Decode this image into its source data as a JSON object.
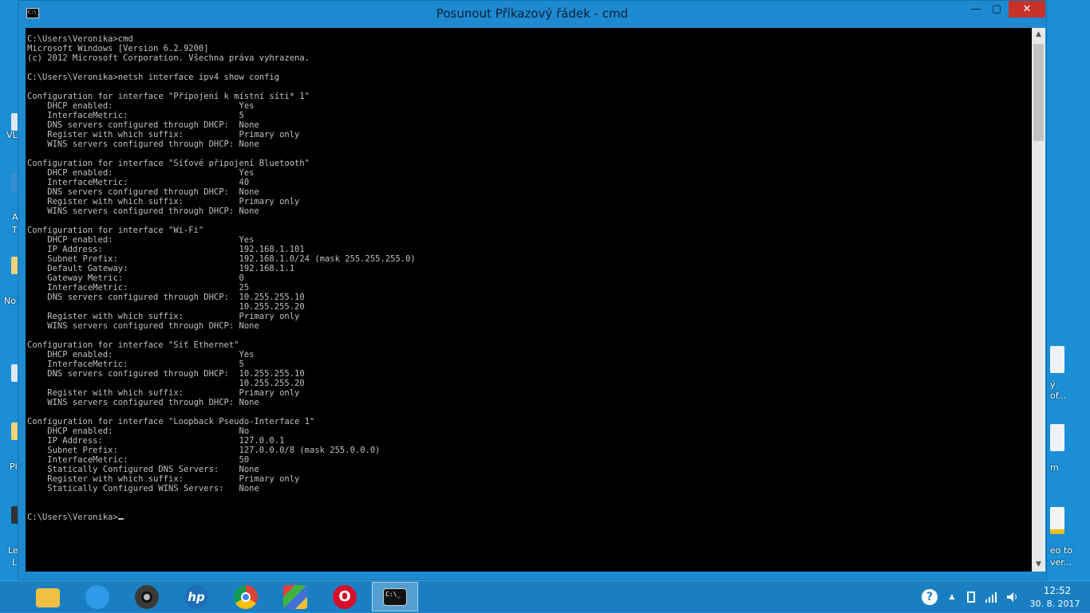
{
  "window": {
    "title": "Posunout Příkazový řádek - cmd",
    "icon_label": "C:\\_",
    "min_label": "—",
    "max_label": "▢",
    "close_label": "✕"
  },
  "console": {
    "lines": [
      "C:\\Users\\Veronika>cmd",
      "Microsoft Windows [Version 6.2.9200]",
      "(c) 2012 Microsoft Corporation. Všechna práva vyhrazena.",
      "",
      "C:\\Users\\Veronika>netsh interface ipv4 show config",
      "",
      "Configuration for interface \"Připojení k místní síti* 1\"",
      "    DHCP enabled:                         Yes",
      "    InterfaceMetric:                      5",
      "    DNS servers configured through DHCP:  None",
      "    Register with which suffix:           Primary only",
      "    WINS servers configured through DHCP: None",
      "",
      "Configuration for interface \"Síťové připojení Bluetooth\"",
      "    DHCP enabled:                         Yes",
      "    InterfaceMetric:                      40",
      "    DNS servers configured through DHCP:  None",
      "    Register with which suffix:           Primary only",
      "    WINS servers configured through DHCP: None",
      "",
      "Configuration for interface \"Wi-Fi\"",
      "    DHCP enabled:                         Yes",
      "    IP Address:                           192.168.1.101",
      "    Subnet Prefix:                        192.168.1.0/24 (mask 255.255.255.0)",
      "    Default Gateway:                      192.168.1.1",
      "    Gateway Metric:                       0",
      "    InterfaceMetric:                      25",
      "    DNS servers configured through DHCP:  10.255.255.10",
      "                                          10.255.255.20",
      "    Register with which suffix:           Primary only",
      "    WINS servers configured through DHCP: None",
      "",
      "Configuration for interface \"Síť Ethernet\"",
      "    DHCP enabled:                         Yes",
      "    InterfaceMetric:                      5",
      "    DNS servers configured through DHCP:  10.255.255.10",
      "                                          10.255.255.20",
      "    Register with which suffix:           Primary only",
      "    WINS servers configured through DHCP: None",
      "",
      "Configuration for interface \"Loopback Pseudo-Interface 1\"",
      "    DHCP enabled:                         No",
      "    IP Address:                           127.0.0.1",
      "    Subnet Prefix:                        127.0.0.0/8 (mask 255.0.0.0)",
      "    InterfaceMetric:                      50",
      "    Statically Configured DNS Servers:    None",
      "    Register with which suffix:           Primary only",
      "    Statically Configured WINS Servers:   None",
      "",
      ""
    ],
    "prompt": "C:\\Users\\Veronika>"
  },
  "desktop": {
    "left_labels": [
      "VL",
      "A",
      "T",
      "No",
      "Pl",
      "Le",
      "L"
    ],
    "right_labels": [
      "ý",
      "of...",
      "m",
      "eo to",
      "ver..."
    ]
  },
  "taskbar": {
    "apps": [
      {
        "name": "file-explorer",
        "color": "#f0c040"
      },
      {
        "name": "internet-explorer",
        "color": "#2f9be8"
      },
      {
        "name": "webcam",
        "color": "#3a3a3a"
      },
      {
        "name": "hp",
        "color": "#1e6fb8"
      },
      {
        "name": "chrome",
        "color": "#e8b020"
      },
      {
        "name": "puzzle-app",
        "color": "#2b2b2b"
      },
      {
        "name": "opera",
        "color": "#d4102a"
      },
      {
        "name": "command-prompt",
        "color": "#111111"
      }
    ],
    "tray": {
      "help": "?",
      "chevron": "▲",
      "clock_time": "12:52",
      "clock_date": "30. 8. 2017"
    },
    "icon_glyphs": {
      "hp": "hp",
      "opera": "O",
      "cmd": "C:\\_"
    }
  }
}
